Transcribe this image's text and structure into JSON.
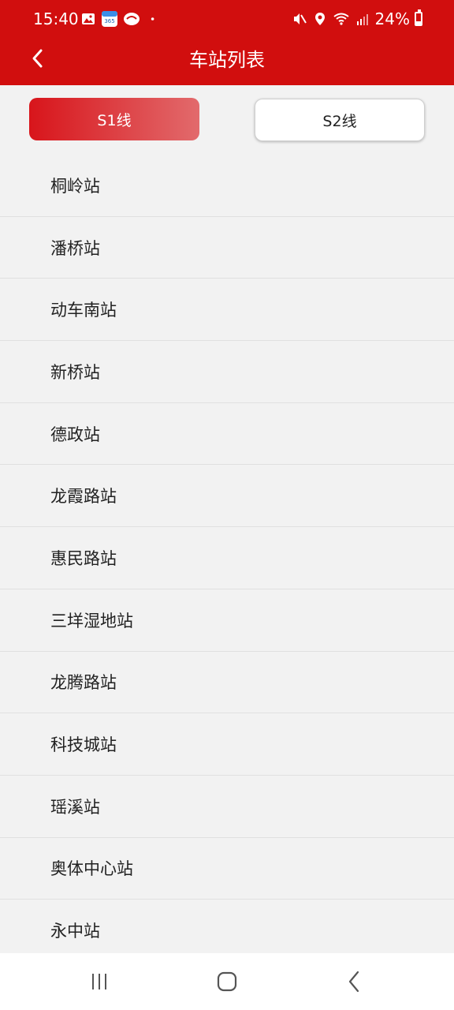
{
  "status_bar": {
    "time": "15:40",
    "battery": "24%",
    "icons": [
      "gallery-icon",
      "calendar-app-icon",
      "app-icon",
      "dot-icon",
      "mute-icon",
      "location-icon",
      "wifi-icon",
      "signal-icon",
      "battery-icon"
    ],
    "calendar_icon_text": "365"
  },
  "header": {
    "title": "车站列表",
    "back_icon": "chevron-left-icon"
  },
  "tabs": [
    {
      "label": "S1线",
      "active": true
    },
    {
      "label": "S2线",
      "active": false
    }
  ],
  "stations": [
    "桐岭站",
    "潘桥站",
    "动车南站",
    "新桥站",
    "德政站",
    "龙霞路站",
    "惠民路站",
    "三垟湿地站",
    "龙腾路站",
    "科技城站",
    "瑶溪站",
    "奥体中心站",
    "永中站"
  ],
  "nav_bar": {
    "icons": [
      "recent-apps-icon",
      "home-icon",
      "back-icon"
    ]
  },
  "colors": {
    "primary": "#d10e0e",
    "tab_gradient_end": "#e26a6c",
    "background": "#f2f2f2"
  }
}
